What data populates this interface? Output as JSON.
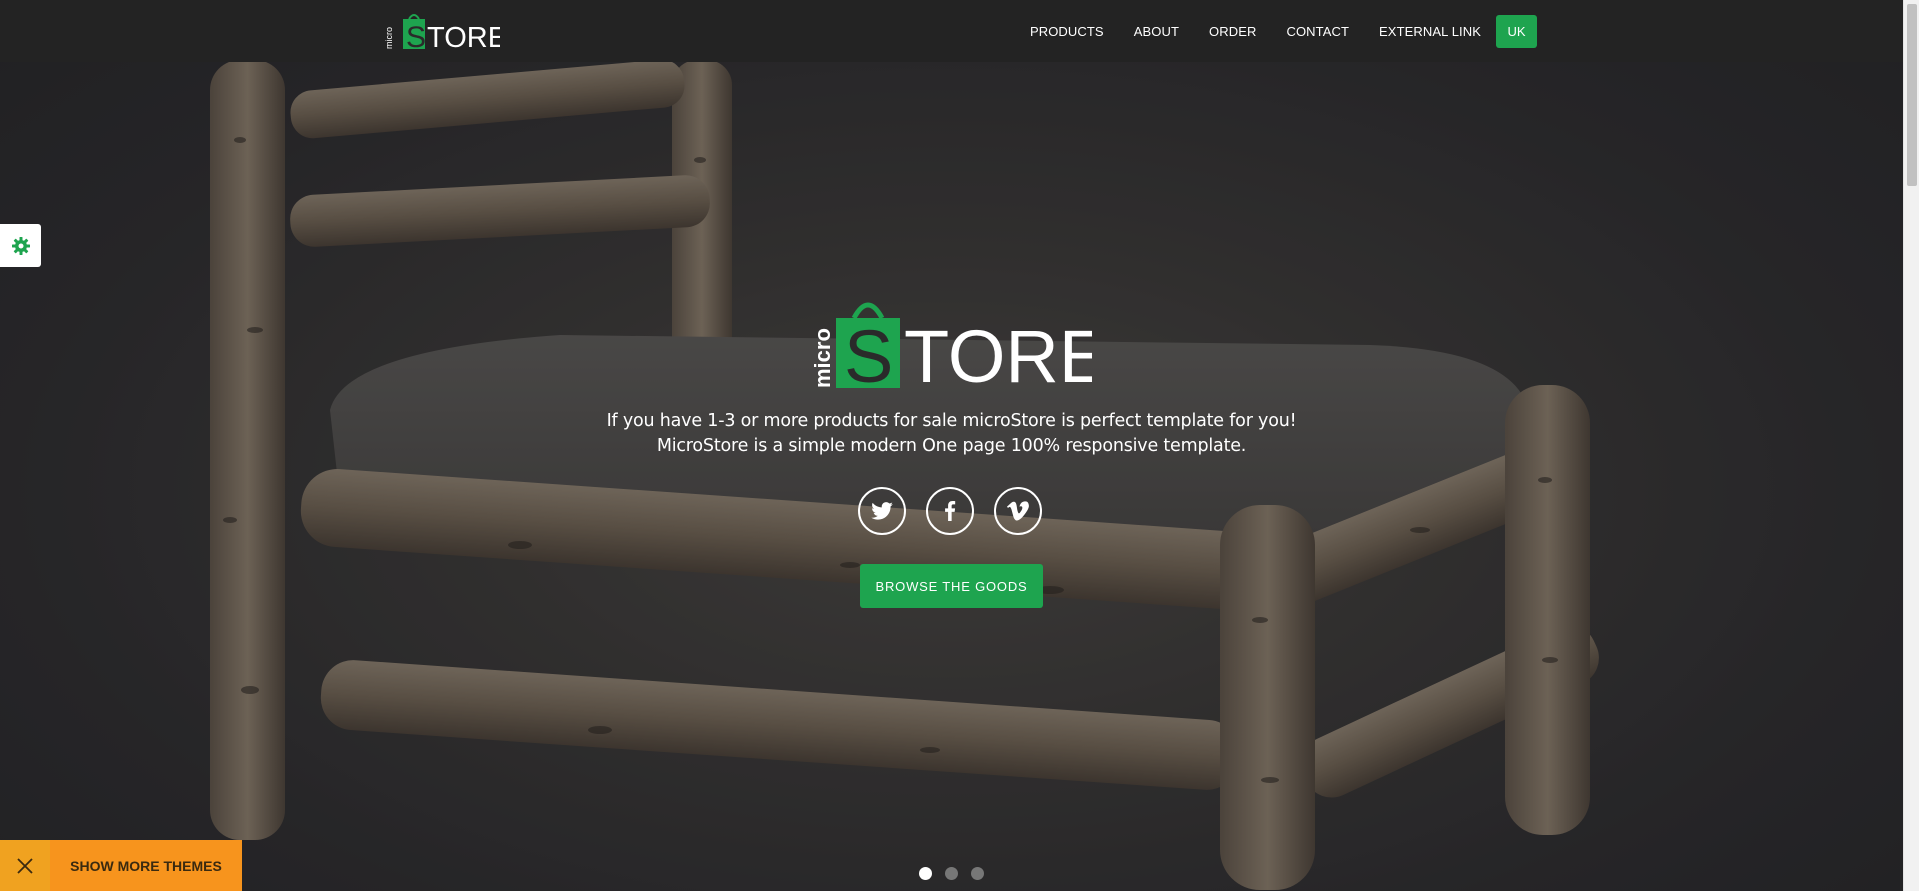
{
  "navbar": {
    "logo": {
      "micro": "micro",
      "store": "TORE",
      "letter": "S"
    },
    "links": [
      "PRODUCTS",
      "ABOUT",
      "ORDER",
      "CONTACT",
      "EXTERNAL LINK"
    ],
    "language": "UK"
  },
  "hero": {
    "logo": {
      "micro": "micro",
      "store": "TORE",
      "letter": "S"
    },
    "line1": "If you have 1-3 or more products for sale microStore is perfect template for you!",
    "line2": "MicroStore is a simple modern One page 100% responsive template.",
    "socials": [
      "twitter-icon",
      "facebook-icon",
      "vimeo-icon"
    ],
    "cta": "BROWSE THE GOODS"
  },
  "slider": {
    "dots": 3,
    "active": 1
  },
  "themes_bar": {
    "label": "SHOW MORE THEMES"
  },
  "colors": {
    "brand_green": "#1ea44f",
    "nav_bg": "#232323",
    "themes_orange": "#f7941d"
  }
}
